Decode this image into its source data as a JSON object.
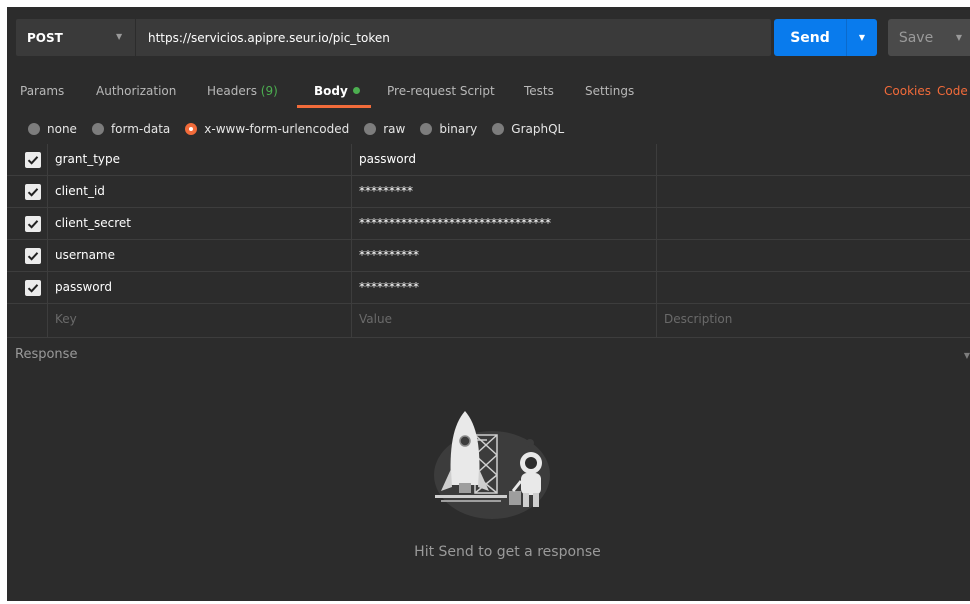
{
  "request": {
    "method": "POST",
    "url": "https://servicios.apipre.seur.io/pic_token",
    "send_label": "Send",
    "save_label": "Save"
  },
  "tabs": [
    {
      "label": "Params"
    },
    {
      "label": "Authorization"
    },
    {
      "label": "Headers",
      "count": "(9)"
    },
    {
      "label": "Body",
      "active": true
    },
    {
      "label": "Pre-request Script"
    },
    {
      "label": "Tests"
    },
    {
      "label": "Settings"
    }
  ],
  "links": {
    "cookies": "Cookies",
    "code": "Code"
  },
  "body_modes": [
    {
      "label": "none",
      "selected": false
    },
    {
      "label": "form-data",
      "selected": false
    },
    {
      "label": "x-www-form-urlencoded",
      "selected": true
    },
    {
      "label": "raw",
      "selected": false
    },
    {
      "label": "binary",
      "selected": false
    },
    {
      "label": "GraphQL",
      "selected": false
    }
  ],
  "params": [
    {
      "key": "grant_type",
      "value": "password",
      "checked": true
    },
    {
      "key": "client_id",
      "value": "*********",
      "checked": true
    },
    {
      "key": "client_secret",
      "value": "********************************",
      "checked": true
    },
    {
      "key": "username",
      "value": "**********",
      "checked": true
    },
    {
      "key": "password",
      "value": "**********",
      "checked": true
    }
  ],
  "placeholders": {
    "key": "Key",
    "value": "Value",
    "description": "Description"
  },
  "response": {
    "title": "Response",
    "hint": "Hit Send to get a response"
  },
  "colors": {
    "accent": "#f26b3a",
    "send": "#097bed",
    "active_dot": "#4caf50"
  }
}
